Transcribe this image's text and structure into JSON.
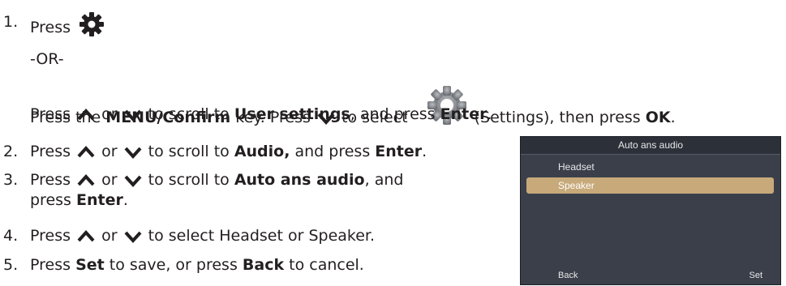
{
  "steps": [
    {
      "number": "1.",
      "press": "Press"
    },
    {
      "or_text": "-OR-"
    },
    {
      "press": "Press the",
      "menu_key": "MENU/Confirm",
      "key_text": " key. Press",
      "select_text": " to select",
      "settings_text": " (Settings), then press",
      "ok": "OK",
      "period": "."
    },
    {
      "press": "Press",
      "or": " or ",
      "scroll_text": " to scroll to",
      "target": "User settings",
      "and_press": ", and press",
      "enter": "Enter",
      "period": "."
    },
    {
      "number": "2.",
      "press": "Press",
      "or": " or ",
      "scroll_text": " to scroll to",
      "target": "Audio,",
      "and_press": " and press",
      "enter": "Enter",
      "period": "."
    },
    {
      "number": "3.",
      "press": "Press",
      "or": " or ",
      "scroll_text": " to scroll to",
      "target": "Auto ans audio",
      "and_press": ", and",
      "press2": "press",
      "enter": "Enter",
      "period": "."
    },
    {
      "number": "4.",
      "press": "Press",
      "or": " or ",
      "text": " to select Headset or Speaker."
    },
    {
      "number": "5.",
      "press": "Press",
      "set": "Set",
      "save_text": " to save, or press",
      "back": "Back",
      "cancel_text": " to cancel."
    }
  ],
  "screen": {
    "title": "Auto ans audio",
    "options": [
      {
        "label": "Headset",
        "selected": false
      },
      {
        "label": "Speaker",
        "selected": true
      }
    ],
    "left_soft": "Back",
    "right_soft": "Set"
  },
  "icons": {
    "gear": "gear-icon",
    "up": "chevron-up-icon",
    "down": "chevron-down-icon",
    "settings": "settings-app-icon"
  },
  "colors": {
    "highlight": "#c7a97a",
    "screen_bg": "#3a3f4a"
  }
}
